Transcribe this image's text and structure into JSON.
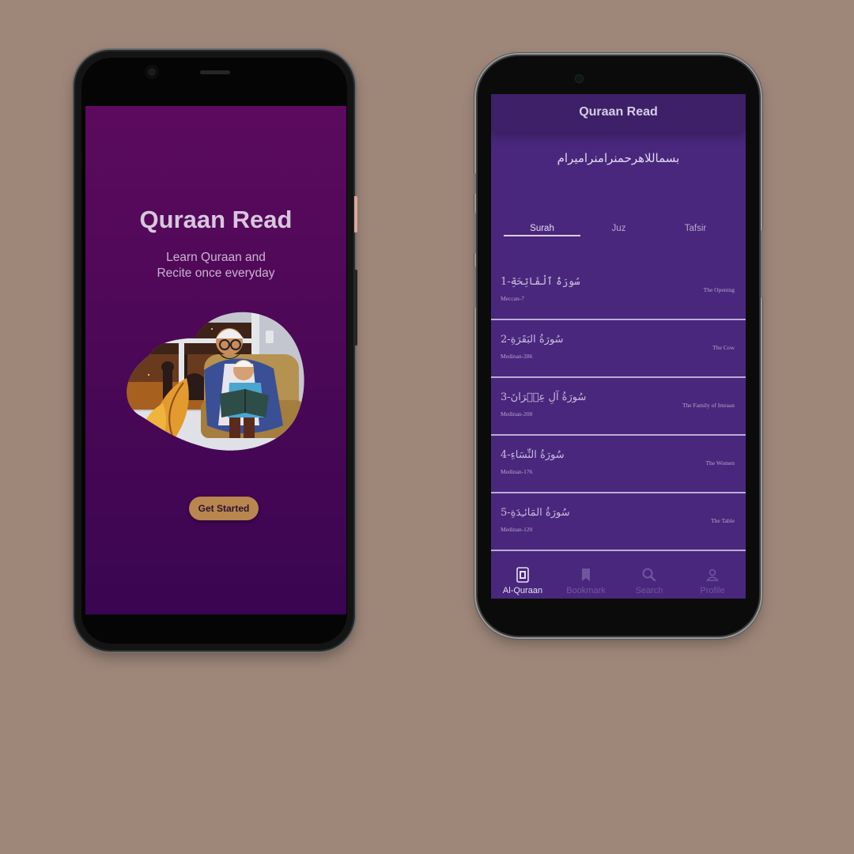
{
  "splash": {
    "title": "Quraan Read",
    "subtitle_line1": "Learn Quraan and",
    "subtitle_line2": "Recite once everyday",
    "button_label": "Get Started"
  },
  "home": {
    "header_title": "Quraan Read",
    "bismillah": "بسماللاهرحمنرامنرامیرام",
    "tabs": [
      {
        "label": "Surah",
        "active": true
      },
      {
        "label": "Juz",
        "active": false
      },
      {
        "label": "Tafsir",
        "active": false
      }
    ],
    "surahs": [
      {
        "name": "سُورَةُ ٱلْفَاتِحَةِ-1",
        "meta": "Meccan-7",
        "english": "The Opening"
      },
      {
        "name": "سُورَةُ البَقَرَةِ-2",
        "meta": "Medinan-286",
        "english": "The Cow"
      },
      {
        "name": "سُورَةُ آلِ عِمۡرَانَ-3",
        "meta": "Medinan-200",
        "english": "The Family of Imraan"
      },
      {
        "name": "سُورَةُ النِّسَاءِ-4",
        "meta": "Medinan-176",
        "english": "The Women"
      },
      {
        "name": "سُورَةُ المَائـِدَةِ-5",
        "meta": "Medinan-120",
        "english": "The Table"
      }
    ],
    "nav": [
      {
        "label": "Al-Quraan",
        "icon": "book-icon",
        "active": true
      },
      {
        "label": "Bookmark",
        "icon": "bookmark-icon",
        "active": false
      },
      {
        "label": "Search",
        "icon": "search-icon",
        "active": false
      },
      {
        "label": "Profile",
        "icon": "profile-icon",
        "active": false
      }
    ]
  },
  "colors": {
    "background": "#9e8679",
    "splash_gradient_top": "#5c0a5e",
    "splash_gradient_bottom": "#3a0552",
    "accent_button": "#b9864f",
    "home_background": "#49277d",
    "home_header": "#3d2068"
  }
}
